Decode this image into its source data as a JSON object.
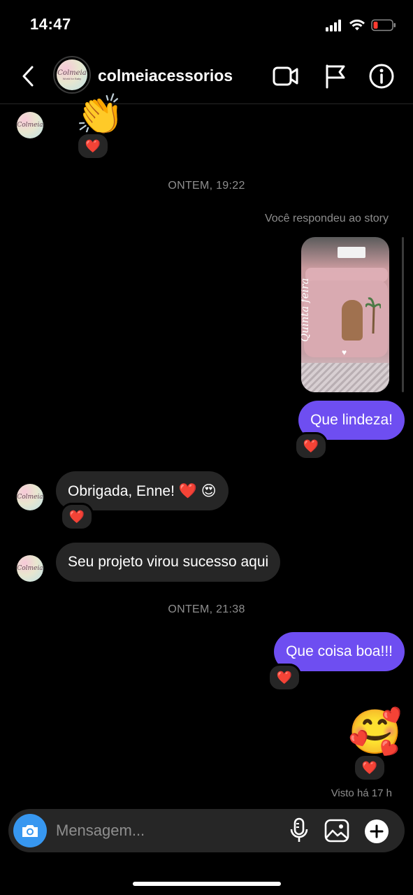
{
  "status_bar": {
    "time": "14:47"
  },
  "header": {
    "username": "colmeiacessorios",
    "avatar_text": "Colmeia",
    "avatar_subtext": "World for Baby"
  },
  "messages": {
    "top_emoji": "👏",
    "stamp_1": "ONTEM, 19:22",
    "story_note": "Você respondeu ao story",
    "story_text": "Quinta feira",
    "msg_que_lindeza": "Que lindeza!",
    "msg_obrigada": "Obrigada, Enne! ❤️ 😍",
    "msg_projeto": "Seu projeto virou sucesso aqui",
    "stamp_2": "ONTEM, 21:38",
    "msg_coisa_boa": "Que coisa boa!!!",
    "big_emoji": "🥰",
    "seen": "Visto há 17 h",
    "reaction": "❤️"
  },
  "composer": {
    "placeholder": "Mensagem..."
  },
  "colors": {
    "sent_bubble": "#6e4ef1",
    "received_bubble": "#262626",
    "camera_button": "#3797f0"
  }
}
